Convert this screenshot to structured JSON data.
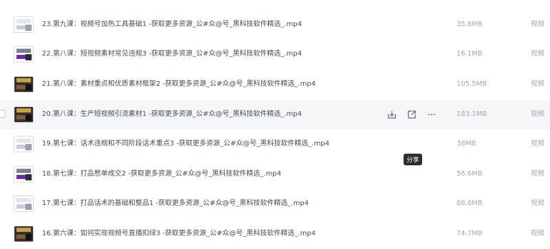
{
  "files": [
    {
      "name": "23.第九课：视频号加热工具基础1 -获取更多资源_公#众@号_黑科技软件精选_.mp4",
      "size": "35.8MB",
      "type": "视频",
      "thumb": "light"
    },
    {
      "name": "22.第八课：短视频素材常见违规3 -获取更多资源_公#众@号_黑科技软件精选_.mp4",
      "size": "16.1MB",
      "type": "视频",
      "thumb": "default"
    },
    {
      "name": "21.第八课：素材重点和优质素材框架2 -获取更多资源_公#众@号_黑科技软件精选_.mp4",
      "size": "105.5MB",
      "type": "视频",
      "thumb": "dark"
    },
    {
      "name": "20.第八课：生产短视频引流素材1 -获取更多资源_公#众@号_黑科技软件精选_.mp4",
      "size": "183.1MB",
      "type": "视频",
      "thumb": "dark"
    },
    {
      "name": "19.第七课：话术违规和不同阶段话术重点3 -获取更多资源_公#众@号_黑科技软件精选_.mp4",
      "size": "38MB",
      "type": "视频",
      "thumb": "light"
    },
    {
      "name": "18.第七课：打品憋单成交2 -获取更多资源_公#众@号_黑科技软件精选_.mp4",
      "size": "56.6MB",
      "type": "视频",
      "thumb": "default"
    },
    {
      "name": "17.第七课：打品话术的基础和整品1 -获取更多资源_公#众@号_黑科技软件精选_.mp4",
      "size": "88.6MB",
      "type": "视频",
      "thumb": "light"
    },
    {
      "name": "16.第六课：如何实现视频号直播扣绿3 -获取更多资源_公#众@号_黑科技软件精选_.mp4",
      "size": "74.7MB",
      "type": "视频",
      "thumb": "dark"
    }
  ],
  "hover_actions": {
    "download_icon": "download-icon",
    "share_icon": "share-icon",
    "more_icon": "more-icon"
  },
  "tooltip": "分享",
  "colors": {
    "hover_bg": "#f5f6f8",
    "text": "#454d5a",
    "muted": "#a3a8b2"
  }
}
